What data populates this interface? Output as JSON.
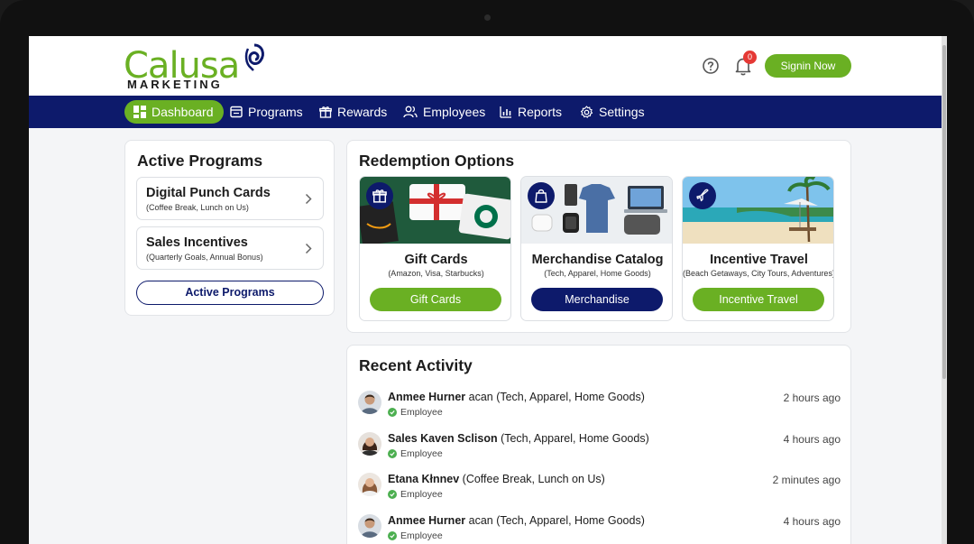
{
  "brand": {
    "name": "Calusa",
    "tagline": "MARKETING"
  },
  "header": {
    "notification_count": "0",
    "signin_label": "Signin Now",
    "icons": [
      "help-icon",
      "bell-icon"
    ]
  },
  "nav": {
    "items": [
      {
        "label": "Dashboard",
        "icon": "dashboard-icon",
        "active": true
      },
      {
        "label": "Programs",
        "icon": "programs-icon"
      },
      {
        "label": "Rewards",
        "icon": "gift-icon"
      },
      {
        "label": "Employees",
        "icon": "users-icon"
      },
      {
        "label": "Reports",
        "icon": "reports-icon"
      },
      {
        "label": "Settings",
        "icon": "gear-icon"
      }
    ]
  },
  "active_programs": {
    "title": "Active Programs",
    "items": [
      {
        "name": "Digital Punch Cards",
        "detail": "(Coffee Break, Lunch on Us)"
      },
      {
        "name": "Sales Incentives",
        "detail": "(Quarterly Goals, Annual Bonus)"
      }
    ],
    "button_label": "Active Programs"
  },
  "redemption": {
    "title": "Redemption Options",
    "options": [
      {
        "title": "Gift Cards",
        "detail": "(Amazon, Visa, Starbucks)",
        "button": "Gift Cards",
        "button_color": "#6ab023",
        "icon": "gift-icon"
      },
      {
        "title": "Merchandise Catalog",
        "detail": "(Tech, Apparel, Home Goods)",
        "button": "Merchandise",
        "button_color": "#0d1a6b",
        "icon": "bag-icon"
      },
      {
        "title": "Incentive Travel",
        "detail": "(Beach Getaways, City Tours, Adventures)",
        "button": "Incentive Travel",
        "button_color": "#6ab023",
        "icon": "plane-icon"
      }
    ]
  },
  "activity": {
    "title": "Recent Activity",
    "rows": [
      {
        "name": "Anmee Hurner",
        "text": " acan (Tech, Apparel, Home Goods)",
        "role": "Employee",
        "time": "2 hours ago"
      },
      {
        "name": "Sales Kaven Sclison",
        "text": " (Tech, Apparel, Home Goods)",
        "role": "Employee",
        "time": "4 hours ago"
      },
      {
        "name": "Etana Kłnnev",
        "text": " (Coffee Break, Lunch on Us)",
        "role": "Employee",
        "time": "2 minutes ago"
      },
      {
        "name": "Anmee Hurner",
        "text": " acan (Tech, Apparel, Home Goods)",
        "role": "Employee",
        "time": "4 hours ago"
      }
    ]
  },
  "colors": {
    "brand_green": "#6ab023",
    "navy": "#0d1a6b",
    "badge_red": "#e53935"
  }
}
